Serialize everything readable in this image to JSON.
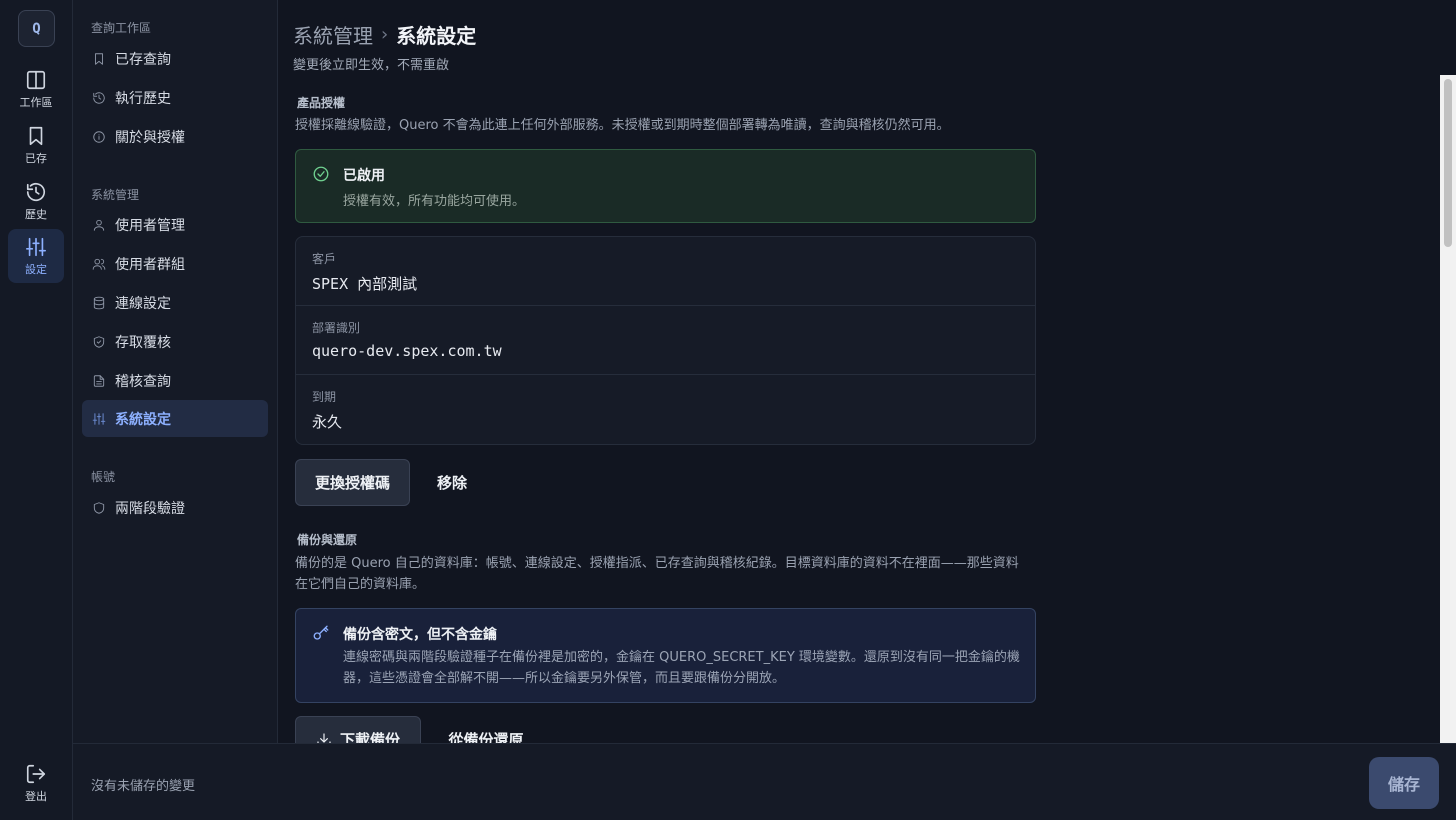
{
  "rail": {
    "logo": "Q",
    "items": [
      {
        "label": "工作區",
        "icon": "columns-icon"
      },
      {
        "label": "已存",
        "icon": "bookmark-icon"
      },
      {
        "label": "歷史",
        "icon": "history-icon"
      },
      {
        "label": "設定",
        "icon": "sliders-icon"
      }
    ],
    "logout": "登出"
  },
  "nav": {
    "sections": [
      {
        "title": "查詢工作區",
        "items": [
          "已存查詢",
          "執行歷史",
          "關於與授權"
        ]
      },
      {
        "title": "系統管理",
        "items": [
          "使用者管理",
          "使用者群組",
          "連線設定",
          "存取覆核",
          "稽核查詢",
          "系統設定"
        ]
      },
      {
        "title": "帳號",
        "items": [
          "兩階段驗證"
        ]
      }
    ]
  },
  "header": {
    "breadcrumb_parent": "系統管理",
    "breadcrumb_sep": "›",
    "breadcrumb_current": "系統設定",
    "subtitle": "變更後立即生效，不需重啟"
  },
  "license": {
    "title": "產品授權",
    "desc": "授權採離線驗證，Quero 不會為此連上任何外部服務。未授權或到期時整個部署轉為唯讀，查詢與稽核仍然可用。",
    "status_title": "已啟用",
    "status_desc": "授權有效，所有功能均可使用。",
    "fields": [
      {
        "label": "客戶",
        "value": "SPEX 內部測試"
      },
      {
        "label": "部署識別",
        "value": "quero-dev.spex.com.tw"
      },
      {
        "label": "到期",
        "value": "永久"
      }
    ],
    "replace_button": "更換授權碼",
    "remove_button": "移除"
  },
  "backup": {
    "title": "備份與還原",
    "desc": "備份的是 Quero 自己的資料庫：帳號、連線設定、授權指派、已存查詢與稽核紀錄。目標資料庫的資料不在裡面——那些資料在它們自己的資料庫。",
    "notice_title": "備份含密文，但不含金鑰",
    "notice_desc": "連線密碼與兩階段驗證種子在備份裡是加密的，金鑰在 QUERO_SECRET_KEY 環境變數。還原到沒有同一把金鑰的機器，這些憑證會全部解不開——所以金鑰要另外保管，而且要跟備份分開放。",
    "download_button": "下載備份",
    "restore_button": "從備份還原"
  },
  "footer": {
    "unsaved_text": "沒有未儲存的變更",
    "save_button": "儲存"
  }
}
